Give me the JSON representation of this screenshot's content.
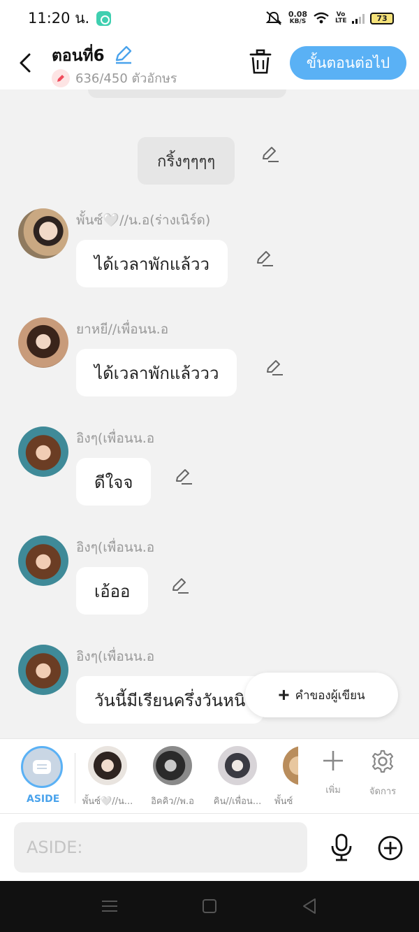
{
  "status_bar": {
    "time": "11:20 น.",
    "speed_top": "0.08",
    "speed_bottom": "KB/S",
    "network": "Vo LTE",
    "battery": "73"
  },
  "header": {
    "title": "ตอนที่6",
    "counter_current": "636",
    "counter_text": "636/450 ตัวอักษร",
    "next_button": "ขั้นตอนต่อไป"
  },
  "chat": {
    "narration": "กริ้งๆๆๆๆ",
    "messages": [
      {
        "sender": "พั้นซ์🤍//น.อ(ร่างเนิร์ด)",
        "text": "ได้เวลาพักแล้วว"
      },
      {
        "sender": "ยาหยี//เพื่อนน.อ",
        "text": "ได้เวลาพักแล้ววว"
      },
      {
        "sender": "อิงๆ(เพื่อนน.อ",
        "text": "ดีใจจ"
      },
      {
        "sender": "อิงๆ(เพื่อนน.อ",
        "text": "เอ้ออ"
      },
      {
        "sender": "อิงๆ(เพื่อนน.อ",
        "text": "วันนี้มีเรียนครึ่งวันหนิ"
      }
    ],
    "author_note_button": "คำของผู้เขียน"
  },
  "character_bar": {
    "aside_label": "ASIDE",
    "characters": [
      {
        "name": "พั้นซ์🤍//น..."
      },
      {
        "name": "อิคคิว//พ.อ"
      },
      {
        "name": "คิน//เพื่อน..."
      },
      {
        "name": "พั้นซ์"
      }
    ],
    "add_label": "เพิ่ม",
    "manage_label": "จัดการ"
  },
  "input": {
    "placeholder": "ASIDE:"
  },
  "colors": {
    "accent": "#5ab1f5",
    "bubble": "#ffffff",
    "narration_bg": "#e6e6e6",
    "background": "#f2f2f2"
  }
}
